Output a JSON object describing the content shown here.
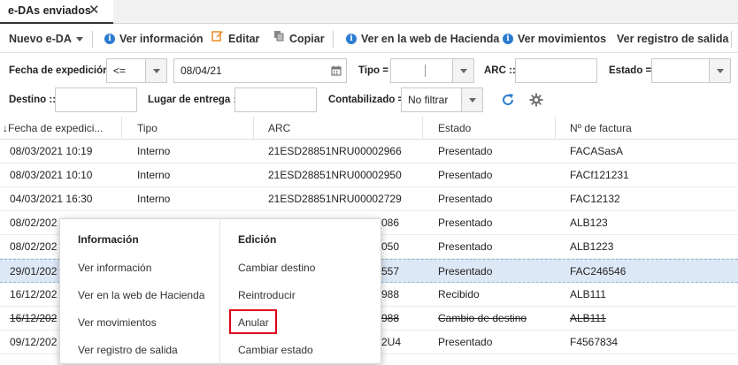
{
  "tab": {
    "label": "e-DAs enviados",
    "close": "✕"
  },
  "toolbar": {
    "nuevo": "Nuevo e-DA",
    "ver_info": "Ver información",
    "editar": "Editar",
    "copiar": "Copiar",
    "ver_web": "Ver en la web de Hacienda",
    "ver_mov": "Ver movimientos",
    "ver_reg": "Ver registro de salida"
  },
  "filters": {
    "fecha_label": "Fecha de expedición",
    "fecha_op": "<=",
    "fecha_value": "08/04/21",
    "tipo_label": "Tipo =",
    "tipo_value": "",
    "arc_label": "ARC ::",
    "arc_value": "",
    "estado_label": "Estado =",
    "estado_value": "",
    "destino_label": "Destino ::",
    "destino_value": "",
    "lugar_label": "Lugar de entrega ::",
    "lugar_value": "",
    "contab_label": "Contabilizado =",
    "contab_value": "No filtrar"
  },
  "grid": {
    "headers": {
      "fecha": "Fecha de expedici...",
      "sort_arrow": "↓",
      "tipo": "Tipo",
      "arc": "ARC",
      "estado": "Estado",
      "factura": "Nº de factura"
    },
    "rows": [
      {
        "fecha": "08/03/2021 10:19",
        "tipo": "Interno",
        "arc": "21ESD28851NRU00002966",
        "estado": "Presentado",
        "factura": "FACASasA"
      },
      {
        "fecha": "08/03/2021 10:10",
        "tipo": "Interno",
        "arc": "21ESD28851NRU00002950",
        "estado": "Presentado",
        "factura": "FACf121231"
      },
      {
        "fecha": "04/03/2021 16:30",
        "tipo": "Interno",
        "arc": "21ESD28851NRU00002729",
        "estado": "Presentado",
        "factura": "FAC12132"
      },
      {
        "fecha": "08/02/202",
        "tipo": "",
        "arc": "086",
        "estado": "Presentado",
        "factura": "ALB123"
      },
      {
        "fecha": "08/02/202",
        "tipo": "",
        "arc": "050",
        "estado": "Presentado",
        "factura": "ALB1223"
      },
      {
        "fecha": "29/01/202",
        "tipo": "",
        "arc": "557",
        "estado": "Presentado",
        "factura": "FAC246546"
      },
      {
        "fecha": "16/12/202",
        "tipo": "",
        "arc": "988",
        "estado": "Recibido",
        "factura": "ALB111"
      },
      {
        "fecha": "16/12/202",
        "tipo": "",
        "arc": "988",
        "estado": "Cambio de destino",
        "factura": "ALB111"
      },
      {
        "fecha": "09/12/202",
        "tipo": "",
        "arc": "2U4",
        "estado": "Presentado",
        "factura": "F4567834"
      }
    ]
  },
  "context_menu": {
    "info_header": "Información",
    "info_items": [
      "Ver información",
      "Ver en la web de Hacienda",
      "Ver movimientos",
      "Ver registro de salida"
    ],
    "edit_header": "Edición",
    "edit_items": [
      "Cambiar destino",
      "Reintroducir",
      "Anular",
      "Cambiar estado"
    ]
  },
  "colors": {
    "accent": "#2b7bd0",
    "edit_icon": "#f08a24",
    "highlight": "#e0001a",
    "selected_row": "#dde8f6"
  }
}
